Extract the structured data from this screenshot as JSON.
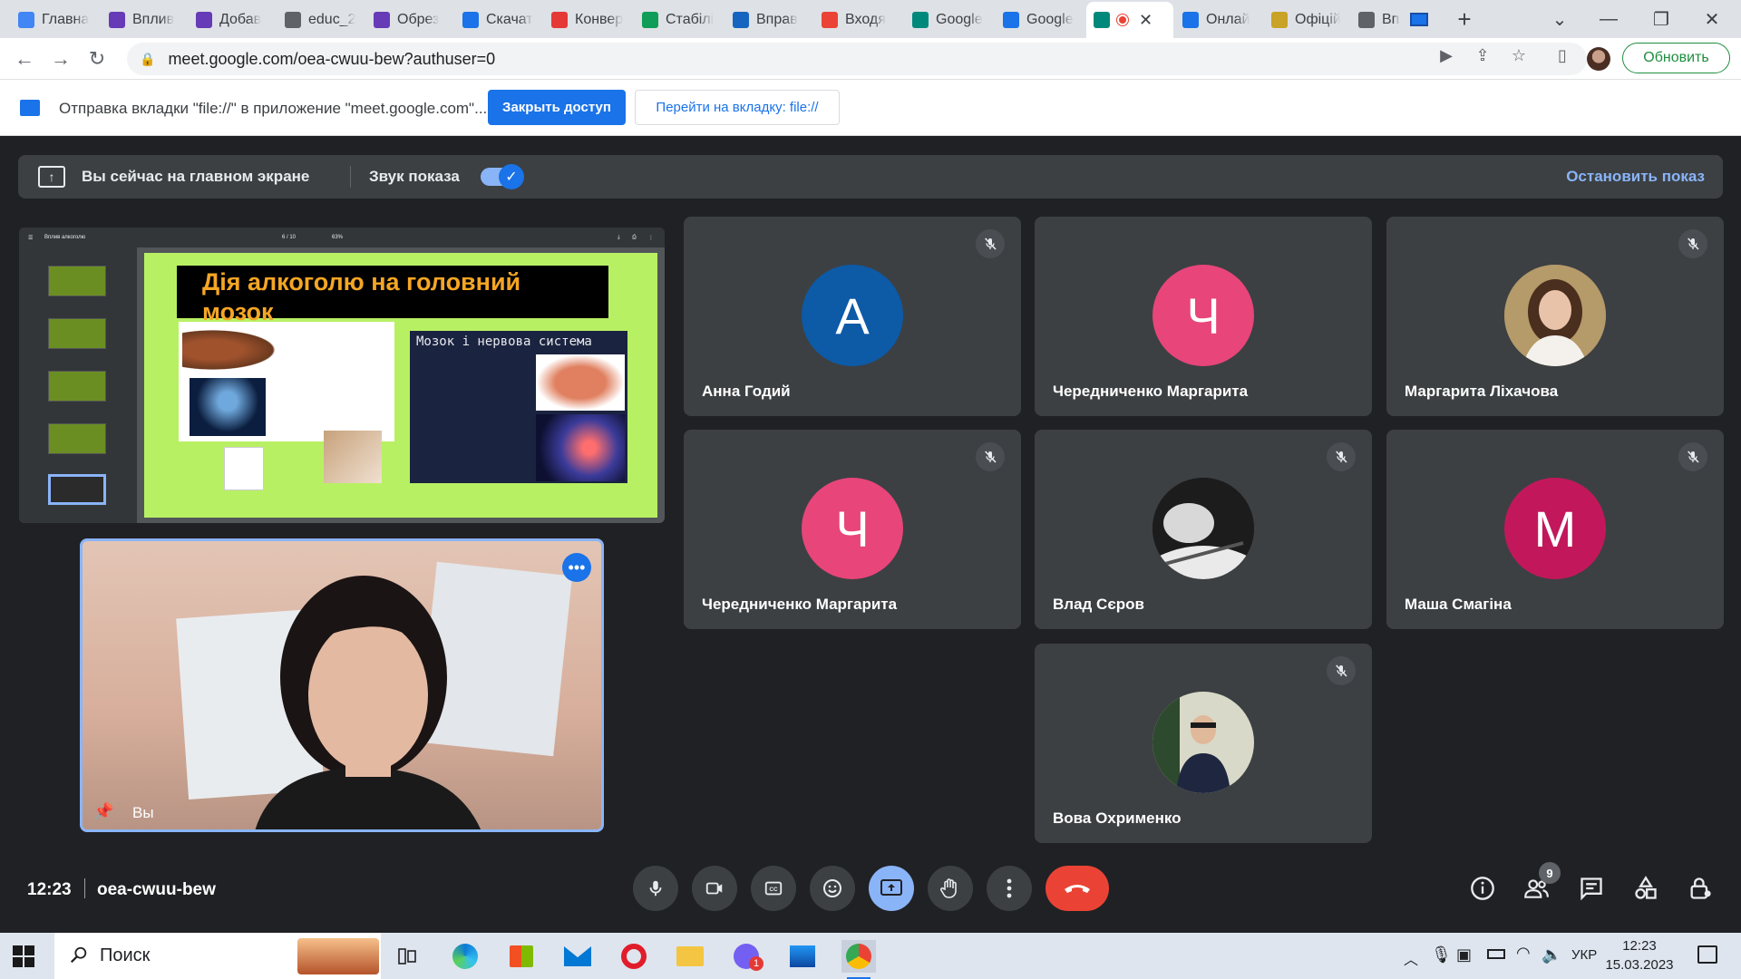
{
  "browser": {
    "tabs": [
      {
        "label": "Главна",
        "favicon": "chrome-icon",
        "color": "#4285f4"
      },
      {
        "label": "Вплив",
        "favicon": "shield-icon",
        "color": "#673ab7"
      },
      {
        "label": "Добав",
        "favicon": "shield-icon",
        "color": "#673ab7"
      },
      {
        "label": "educ_2",
        "favicon": "globe-icon",
        "color": "#5f6368"
      },
      {
        "label": "Обрез",
        "favicon": "shield-icon",
        "color": "#673ab7"
      },
      {
        "label": "Скачат",
        "favicon": "heart-icon",
        "color": "#1a73e8"
      },
      {
        "label": "Конвер",
        "favicon": "heart-icon",
        "color": "#e53935"
      },
      {
        "label": "Стабілі",
        "favicon": "sheets-icon",
        "color": "#0f9d58"
      },
      {
        "label": "Вправ",
        "favicon": "letter-a-icon",
        "color": "#1565c0"
      },
      {
        "label": "Входя",
        "favicon": "gmail-icon",
        "color": "#ea4335"
      },
      {
        "label": "Google",
        "favicon": "meet-icon",
        "color": "#00897b"
      },
      {
        "label": "Google",
        "favicon": "calendar-icon",
        "color": "#1a73e8"
      },
      {
        "label": "",
        "favicon": "meet-icon",
        "color": "#00897b",
        "active": true
      },
      {
        "label": "Онлай",
        "favicon": "target-icon",
        "color": "#1a73e8"
      },
      {
        "label": "Офіцій",
        "favicon": "trident-icon",
        "color": "#c9a227"
      },
      {
        "label": "Вп",
        "favicon": "globe-icon",
        "color": "#5f6368"
      }
    ],
    "new_tab": "+",
    "url": "meet.google.com/oea-cwuu-bew?authuser=0",
    "update_label": "Обновить"
  },
  "infobar": {
    "message": "Отправка вкладки \"file://\" в приложение \"meet.google.com\"...",
    "close_access": "Закрыть доступ",
    "goto_tab": "Перейти на вкладку: file://"
  },
  "meet": {
    "banner_text": "Вы сейчас на главном экране",
    "sound_label": "Звук показа",
    "sound_on": true,
    "stop_label": "Остановить показ",
    "slide": {
      "title": "Дія алкоголю на головний мозок",
      "right_box_title": "Мозок і нервова система",
      "page_counter": "6 / 10",
      "zoom": "63%",
      "doc_name": "Вплив алкоголю"
    },
    "self_label": "Вы",
    "participants": [
      {
        "name": "Анна Годий",
        "initial": "А",
        "color": "#0d5aa7",
        "muted": true
      },
      {
        "name": "Чередниченко Маргарита",
        "initial": "Ч",
        "color": "#e8457a",
        "muted": false
      },
      {
        "name": "Маргарита Ліхачова",
        "initial": "",
        "color": "#a08a60",
        "muted": true,
        "photo": "photo-woman"
      },
      {
        "name": "Чередниченко Маргарита",
        "initial": "Ч",
        "color": "#e8457a",
        "muted": true
      },
      {
        "name": "Влад Сєров",
        "initial": "",
        "color": "#222222",
        "muted": true,
        "photo": "photo-car"
      },
      {
        "name": "Маша Смагіна",
        "initial": "М",
        "color": "#c2185b",
        "muted": true
      },
      {
        "name": "Вова Охрименко",
        "initial": "",
        "color": "#556b3f",
        "muted": true,
        "photo": "photo-boy"
      }
    ],
    "time": "12:23",
    "meeting_code": "oea-cwuu-bew",
    "people_count": "9"
  },
  "taskbar": {
    "search_label": "Поиск",
    "lang": "УКР",
    "time": "12:23",
    "date": "15.03.2023",
    "viber_badge": "1"
  }
}
